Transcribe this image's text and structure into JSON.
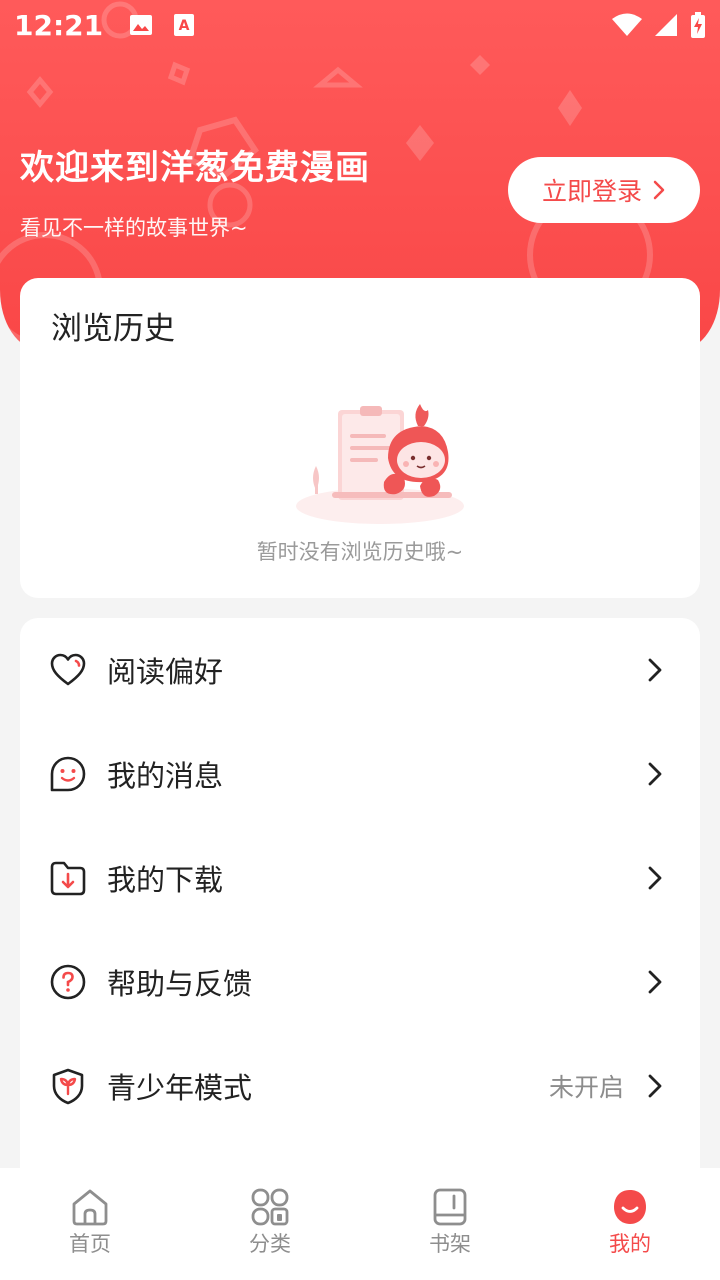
{
  "status_bar": {
    "time": "12:21",
    "icons_left": [
      "image-icon",
      "text-a-icon"
    ],
    "icons_right": [
      "wifi-icon",
      "cellular-icon",
      "battery-charging-icon"
    ]
  },
  "header": {
    "title": "欢迎来到洋葱免费漫画",
    "subtitle": "看见不一样的故事世界~",
    "login_label": "立即登录",
    "background_color": "#f94747"
  },
  "history": {
    "title": "浏览历史",
    "empty_text": "暂时没有浏览历史哦~"
  },
  "menu": {
    "items": [
      {
        "label": "阅读偏好",
        "icon": "heart-icon",
        "value": ""
      },
      {
        "label": "我的消息",
        "icon": "smile-message-icon",
        "value": ""
      },
      {
        "label": "我的下载",
        "icon": "download-folder-icon",
        "value": ""
      },
      {
        "label": "帮助与反馈",
        "icon": "help-circle-icon",
        "value": ""
      },
      {
        "label": "青少年模式",
        "icon": "sprout-shield-icon",
        "value": "未开启"
      }
    ]
  },
  "tabbar": {
    "items": [
      {
        "label": "首页",
        "icon": "home-icon",
        "active": false
      },
      {
        "label": "分类",
        "icon": "category-grid-icon",
        "active": false
      },
      {
        "label": "书架",
        "icon": "bookshelf-icon",
        "active": false
      },
      {
        "label": "我的",
        "icon": "profile-onion-icon",
        "active": true
      }
    ],
    "accent_color": "#f44a4a"
  }
}
